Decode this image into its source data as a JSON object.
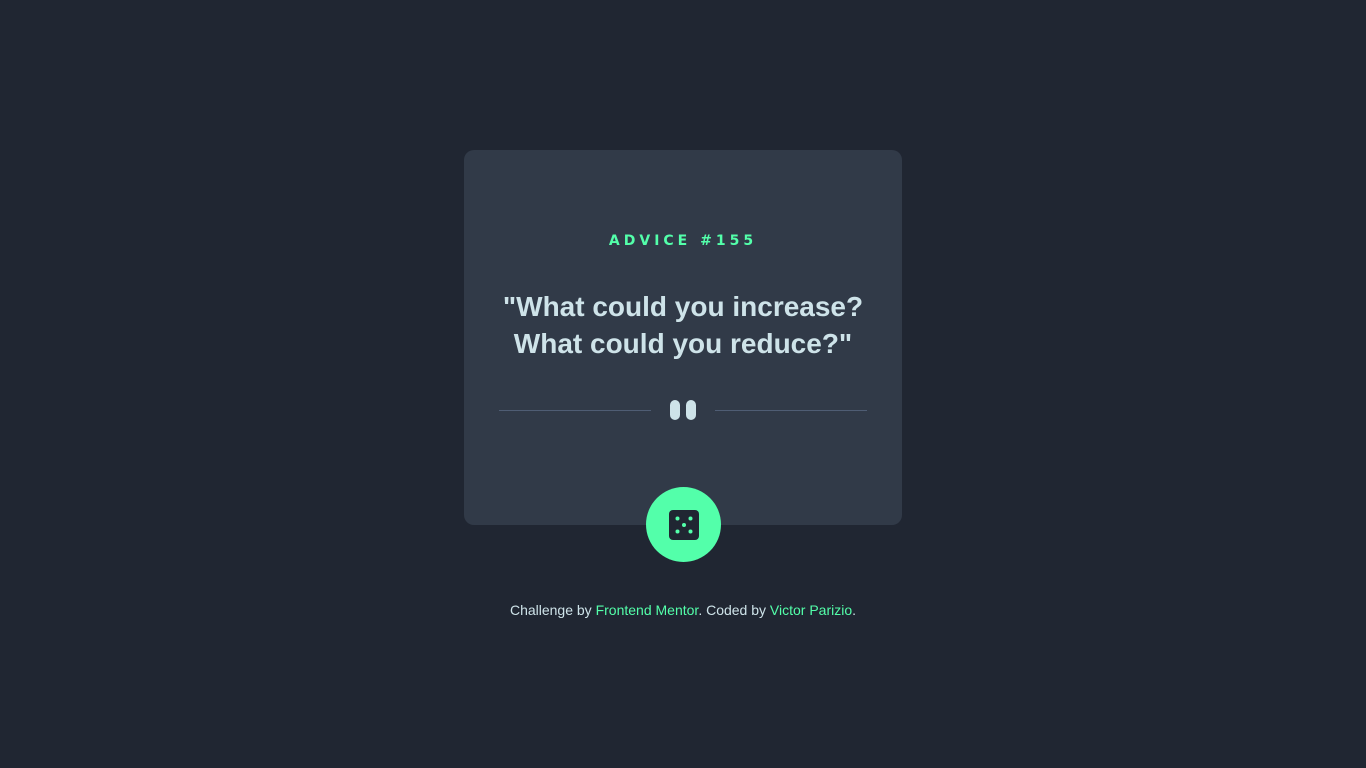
{
  "card": {
    "advice_label": "ADVICE #155",
    "advice_text": "\"What could you increase? What could you reduce?\""
  },
  "divider": {
    "icon": "pause-icon"
  },
  "dice_button": {
    "icon": "dice-icon"
  },
  "footer": {
    "prefix": "Challenge by ",
    "link1": "Frontend Mentor",
    "middle": ". Coded by ",
    "link2": "Victor Parizio",
    "suffix": "."
  },
  "colors": {
    "background": "#202632",
    "card": "#313a48",
    "accent": "#53ffaa",
    "text": "#cee3e9",
    "divider": "#4f5d74"
  }
}
